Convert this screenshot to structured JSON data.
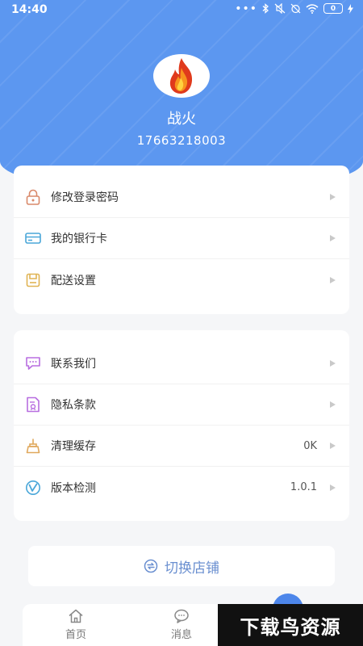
{
  "status_bar": {
    "time": "14:40",
    "dots": "•••",
    "battery": "0"
  },
  "profile": {
    "name": "战火",
    "phone": "17663218003"
  },
  "account_menu": [
    {
      "label": "修改登录密码",
      "icon": "lock-icon"
    },
    {
      "label": "我的银行卡",
      "icon": "bank-card-icon"
    },
    {
      "label": "配送设置",
      "icon": "delivery-settings-icon"
    }
  ],
  "general_menu": [
    {
      "label": "联系我们",
      "icon": "contact-chat-icon"
    },
    {
      "label": "隐私条款",
      "icon": "privacy-document-icon"
    },
    {
      "label": "清理缓存",
      "icon": "broom-icon",
      "value": "0K"
    },
    {
      "label": "版本检测",
      "icon": "version-icon",
      "value": "1.0.1"
    }
  ],
  "switch_store": {
    "label": "切换店铺",
    "icon": "switch-icon"
  },
  "tabbar": [
    {
      "label": "首页",
      "icon": "home-icon"
    },
    {
      "label": "消息",
      "icon": "message-icon"
    }
  ],
  "watermark": "下载鸟资源",
  "colors": {
    "primary": "#5c97f0",
    "accent_text": "#6a8fd0",
    "background": "#f5f6f8"
  }
}
